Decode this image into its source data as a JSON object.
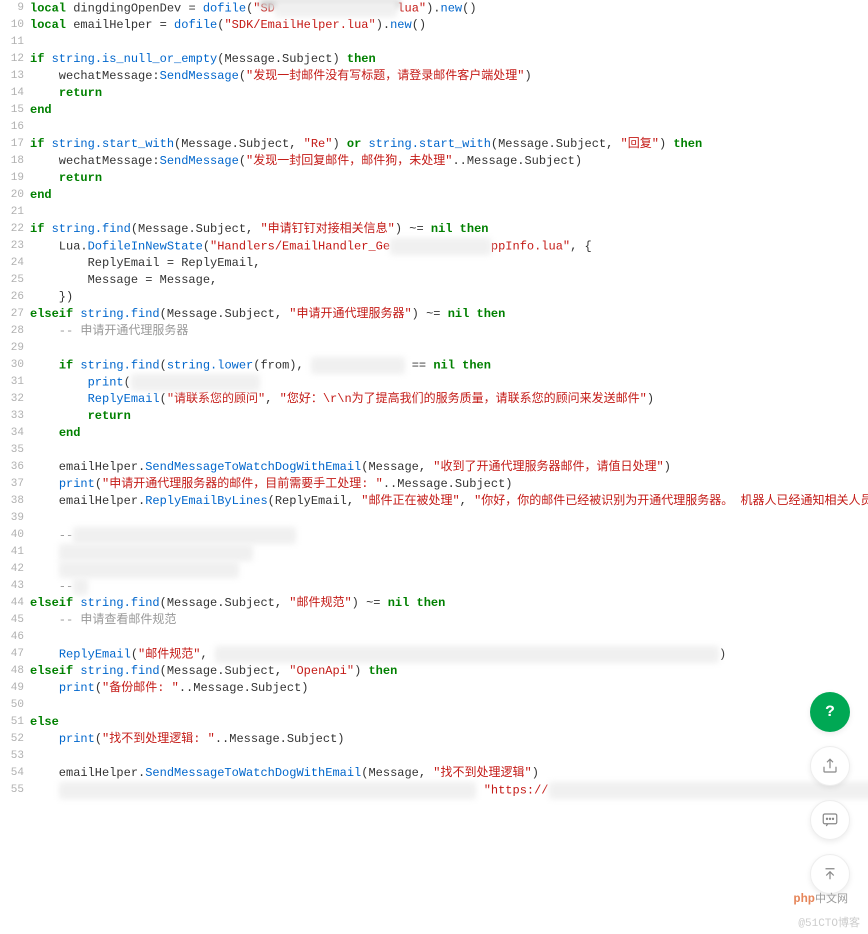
{
  "lineStart": 9,
  "lines": [
    [
      [
        "kw",
        "local"
      ],
      [
        "id",
        " dingdingOpenDev "
      ],
      [
        "op",
        "= "
      ],
      [
        "fn",
        "dofile"
      ],
      [
        "op",
        "("
      ],
      [
        "str",
        "\"SD"
      ],
      [
        "blur",
        "xxxxxxxxxxxxxxxxx"
      ],
      [
        "str",
        "lua\""
      ],
      [
        "op",
        ")."
      ],
      [
        "fn",
        "new"
      ],
      [
        "op",
        "()"
      ]
    ],
    [
      [
        "kw",
        "local"
      ],
      [
        "id",
        " emailHelper "
      ],
      [
        "op",
        "= "
      ],
      [
        "fn",
        "dofile"
      ],
      [
        "op",
        "("
      ],
      [
        "str",
        "\"SDK/EmailHelper.lua\""
      ],
      [
        "op",
        ")."
      ],
      [
        "fn",
        "new"
      ],
      [
        "op",
        "()"
      ]
    ],
    [],
    [
      [
        "kw",
        "if"
      ],
      [
        "id",
        " "
      ],
      [
        "fn",
        "string.is_null_or_empty"
      ],
      [
        "op",
        "(Message.Subject) "
      ],
      [
        "kw",
        "then"
      ]
    ],
    [
      [
        "id",
        "    wechatMessage:"
      ],
      [
        "fn",
        "SendMessage"
      ],
      [
        "op",
        "("
      ],
      [
        "str",
        "\"发现一封邮件没有写标题，请登录邮件客户端处理\""
      ],
      [
        "op",
        ")"
      ]
    ],
    [
      [
        "id",
        "    "
      ],
      [
        "kw",
        "return"
      ]
    ],
    [
      [
        "kw",
        "end"
      ]
    ],
    [],
    [
      [
        "kw",
        "if"
      ],
      [
        "id",
        " "
      ],
      [
        "fn",
        "string.start_with"
      ],
      [
        "op",
        "(Message.Subject, "
      ],
      [
        "str",
        "\"Re\""
      ],
      [
        "op",
        ") "
      ],
      [
        "kw",
        "or"
      ],
      [
        "id",
        " "
      ],
      [
        "fn",
        "string.start_with"
      ],
      [
        "op",
        "(Message.Subject, "
      ],
      [
        "str",
        "\"回复\""
      ],
      [
        "op",
        ") "
      ],
      [
        "kw",
        "then"
      ]
    ],
    [
      [
        "id",
        "    wechatMessage:"
      ],
      [
        "fn",
        "SendMessage"
      ],
      [
        "op",
        "("
      ],
      [
        "str",
        "\"发现一封回复邮件，邮件狗，未处理\""
      ],
      [
        "op",
        "..Message.Subject)"
      ]
    ],
    [
      [
        "id",
        "    "
      ],
      [
        "kw",
        "return"
      ]
    ],
    [
      [
        "kw",
        "end"
      ]
    ],
    [],
    [
      [
        "kw",
        "if"
      ],
      [
        "id",
        " "
      ],
      [
        "fn",
        "string.find"
      ],
      [
        "op",
        "(Message.Subject, "
      ],
      [
        "str",
        "\"申请钉钉对接相关信息\""
      ],
      [
        "op",
        ") ~= "
      ],
      [
        "kw",
        "nil then"
      ]
    ],
    [
      [
        "id",
        "    Lua."
      ],
      [
        "fn",
        "DofileInNewState"
      ],
      [
        "op",
        "("
      ],
      [
        "str",
        "\"Handlers/EmailHandler_Ge"
      ],
      [
        "blur",
        "xxxxxxxxxxxxxx"
      ],
      [
        "str",
        "ppInfo.lua\""
      ],
      [
        "op",
        ", {"
      ]
    ],
    [
      [
        "id",
        "        ReplyEmail = ReplyEmail,"
      ]
    ],
    [
      [
        "id",
        "        Message = Message,"
      ]
    ],
    [
      [
        "id",
        "    })"
      ]
    ],
    [
      [
        "kw",
        "elseif"
      ],
      [
        "id",
        " "
      ],
      [
        "fn",
        "string.find"
      ],
      [
        "op",
        "(Message.Subject, "
      ],
      [
        "str",
        "\"申请开通代理服务器\""
      ],
      [
        "op",
        ") ~= "
      ],
      [
        "kw",
        "nil then"
      ]
    ],
    [
      [
        "cm",
        "    -- 申请开通代理服务器"
      ]
    ],
    [],
    [
      [
        "id",
        "    "
      ],
      [
        "kw",
        "if"
      ],
      [
        "id",
        " "
      ],
      [
        "fn",
        "string.find"
      ],
      [
        "op",
        "("
      ],
      [
        "fn",
        "string.lower"
      ],
      [
        "op",
        "(from), "
      ],
      [
        "blur",
        "xxxxxxxxxxxxx"
      ],
      [
        "op",
        " == "
      ],
      [
        "kw",
        "nil then"
      ]
    ],
    [
      [
        "id",
        "        "
      ],
      [
        "fn",
        "print"
      ],
      [
        "op",
        "("
      ],
      [
        "blur",
        "xxxxxxxxxxxxxxxxxx"
      ]
    ],
    [
      [
        "id",
        "        "
      ],
      [
        "fn",
        "ReplyEmail"
      ],
      [
        "op",
        "("
      ],
      [
        "str",
        "\"请联系您的顾问\""
      ],
      [
        "op",
        ", "
      ],
      [
        "str",
        "\"您好：\\r\\n为了提高我们的服务质量，请联系您的顾问来发送邮件\""
      ],
      [
        "op",
        ")"
      ]
    ],
    [
      [
        "id",
        "        "
      ],
      [
        "kw",
        "return"
      ]
    ],
    [
      [
        "id",
        "    "
      ],
      [
        "kw",
        "end"
      ]
    ],
    [],
    [
      [
        "id",
        "    emailHelper."
      ],
      [
        "fn",
        "SendMessageToWatchDogWithEmail"
      ],
      [
        "op",
        "(Message, "
      ],
      [
        "str",
        "\"收到了开通代理服务器邮件，请值日处理\""
      ],
      [
        "op",
        ")"
      ]
    ],
    [
      [
        "id",
        "    "
      ],
      [
        "fn",
        "print"
      ],
      [
        "op",
        "("
      ],
      [
        "str",
        "\"申请开通代理服务器的邮件，目前需要手工处理: \""
      ],
      [
        "op",
        "..Message.Subject)"
      ]
    ],
    [
      [
        "id",
        "    emailHelper."
      ],
      [
        "fn",
        "ReplyEmailByLines"
      ],
      [
        "op",
        "(ReplyEmail, "
      ],
      [
        "str",
        "\"邮件正在被处理\""
      ],
      [
        "op",
        ", "
      ],
      [
        "str",
        "\"你好，你的邮件已经被识别为开通代理服务器。 机器人已经通知相关人员处理"
      ]
    ],
    [],
    [
      [
        "cm",
        "    --"
      ],
      [
        "blur",
        "xxxxxxxxxxxxxxxxxxxxxxxxxxxxxxx"
      ]
    ],
    [
      [
        "cm",
        "    "
      ],
      [
        "blur",
        "xxxxxxxxxxxxxxxxxxxxxxxxxxx"
      ]
    ],
    [
      [
        "cm",
        "    "
      ],
      [
        "blur",
        "xxxxxxxxxxxxxxxxxxxxxxxxx"
      ]
    ],
    [
      [
        "cm",
        "    --"
      ],
      [
        "blur",
        "xx"
      ]
    ],
    [
      [
        "kw",
        "elseif"
      ],
      [
        "id",
        " "
      ],
      [
        "fn",
        "string.find"
      ],
      [
        "op",
        "(Message.Subject, "
      ],
      [
        "str",
        "\"邮件规范\""
      ],
      [
        "op",
        ") ~= "
      ],
      [
        "kw",
        "nil then"
      ]
    ],
    [
      [
        "cm",
        "    -- 申请查看邮件规范"
      ]
    ],
    [],
    [
      [
        "id",
        "    "
      ],
      [
        "fn",
        "ReplyEmail"
      ],
      [
        "op",
        "("
      ],
      [
        "str",
        "\"邮件规范\""
      ],
      [
        "op",
        ", "
      ],
      [
        "blur",
        "xxxxxxxxxxxxxxxxxxxxxxxxxxxxxxxxxxxxxxxxxxxxxxxxxxxxxxxxxxxxxxxxxxxxxx"
      ],
      [
        "op",
        ")"
      ]
    ],
    [
      [
        "kw",
        "elseif"
      ],
      [
        "id",
        " "
      ],
      [
        "fn",
        "string.find"
      ],
      [
        "op",
        "(Message.Subject, "
      ],
      [
        "str",
        "\"OpenApi\""
      ],
      [
        "op",
        ") "
      ],
      [
        "kw",
        "then"
      ]
    ],
    [
      [
        "id",
        "    "
      ],
      [
        "fn",
        "print"
      ],
      [
        "op",
        "("
      ],
      [
        "str",
        "\"备份邮件: \""
      ],
      [
        "op",
        "..Message.Subject)"
      ]
    ],
    [],
    [
      [
        "kw",
        "else"
      ]
    ],
    [
      [
        "id",
        "    "
      ],
      [
        "fn",
        "print"
      ],
      [
        "op",
        "("
      ],
      [
        "str",
        "\"找不到处理逻辑: \""
      ],
      [
        "op",
        "..Message.Subject)"
      ]
    ],
    [],
    [
      [
        "id",
        "    emailHelper."
      ],
      [
        "fn",
        "SendMessageToWatchDogWithEmail"
      ],
      [
        "op",
        "(Message, "
      ],
      [
        "str",
        "\"找不到处理逻辑\""
      ],
      [
        "op",
        ")"
      ]
    ],
    [
      [
        "id",
        "    "
      ],
      [
        "blur",
        "xxxxxxxxxxxxxxxxxxxxxxxxxxxxxxxxxxxxxxxxxxxxxxxxxxxxxxxxxx"
      ],
      [
        "op",
        " "
      ],
      [
        "str",
        "\"https://"
      ],
      [
        "blur",
        "xxxxxxxxxxxxxxxxxxxxxxxxxxxxxxxxxxxxxxxxxxxxxxxxxxxx"
      ],
      [
        "str",
        "\""
      ]
    ]
  ],
  "watermarks": {
    "php_brand": "php",
    "php_suffix": "中文网",
    "cto": "@51CTO博客"
  },
  "fab": {
    "help": "?",
    "share": "share",
    "comment": "comment",
    "top": "top"
  }
}
